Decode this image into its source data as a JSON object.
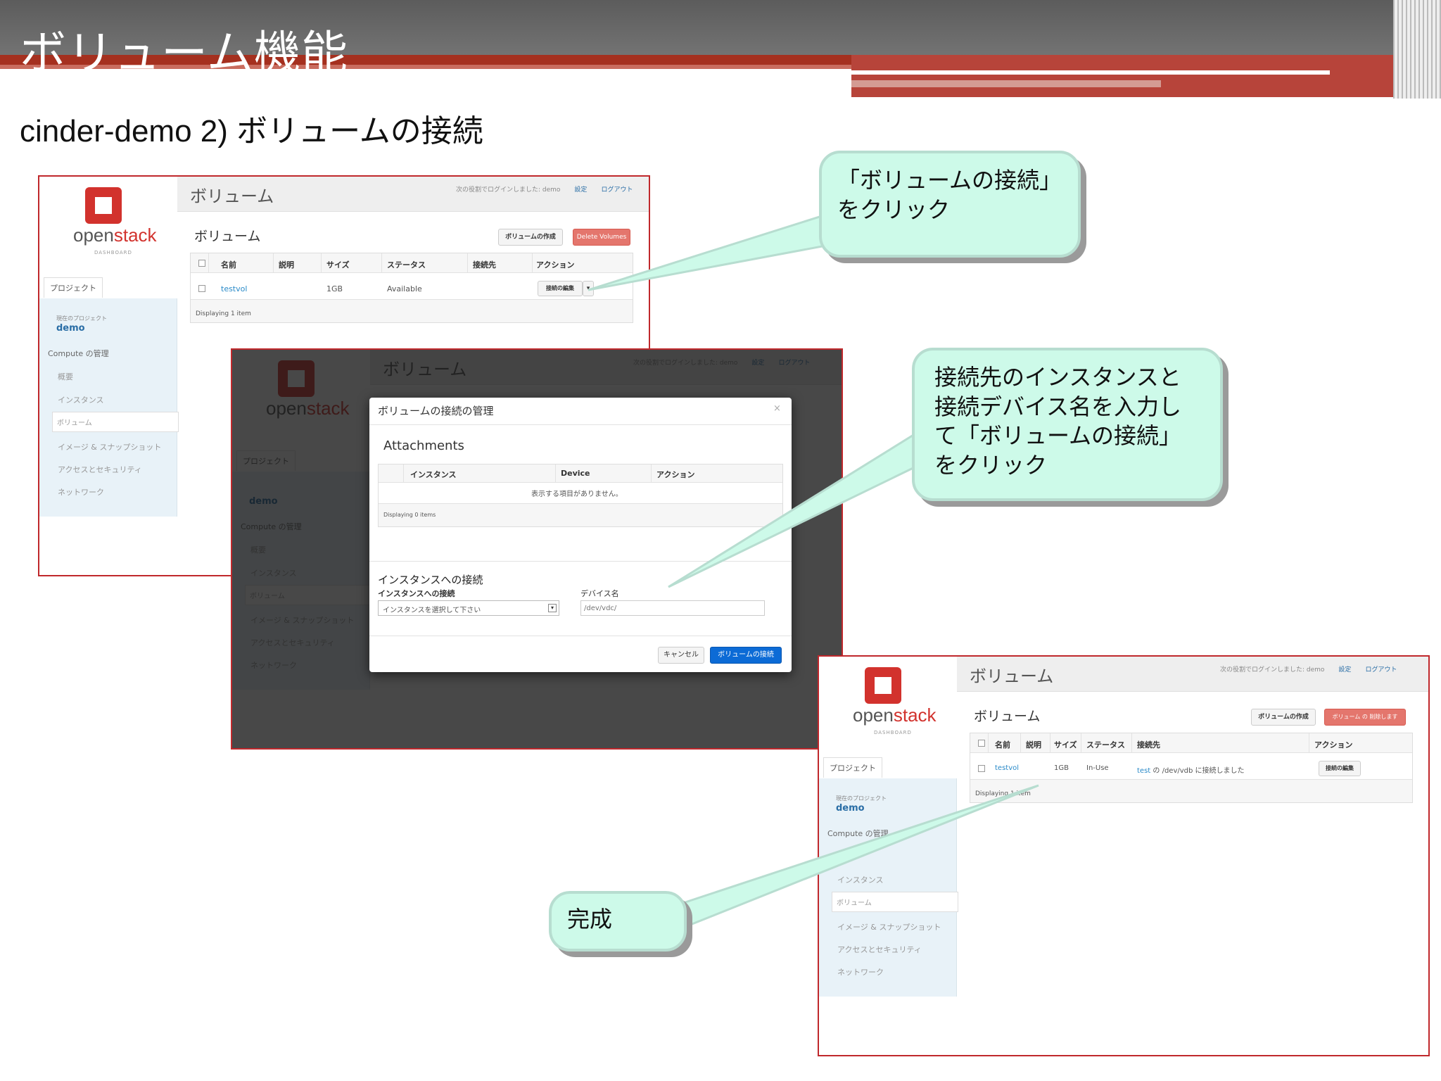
{
  "slide": {
    "title": "ボリューム機能",
    "subtitle": "cinder-demo 2) ボリュームの接続"
  },
  "dashboard": {
    "logo_open": "open",
    "logo_stack": "stack",
    "logo_sub": "DASHBOARD",
    "project_tab": "プロジェクト",
    "current_project_label": "現在のプロジェクト",
    "current_project": "demo",
    "section": "Compute の管理",
    "nav": [
      "概要",
      "インスタンス",
      "ボリューム",
      "イメージ & スナップショット",
      "アクセスとセキュリティ",
      "ネットワーク"
    ],
    "page_title": "ボリューム",
    "logged_in": "次の役割でログインしました: demo",
    "settings": "設定",
    "logout": "ログアウト",
    "table_title": "ボリューム",
    "create_btn": "ボリュームの作成",
    "columns": [
      "名前",
      "説明",
      "サイズ",
      "ステータス",
      "接続先",
      "アクション"
    ]
  },
  "shot1": {
    "delete_btn": "Delete Volumes",
    "row": {
      "name": "testvol",
      "desc": "",
      "size": "1GB",
      "status": "Available",
      "attached": "",
      "action": "接続の編集"
    },
    "footer": "Displaying 1 item"
  },
  "shot2": {
    "modal_title": "ボリュームの接続の管理",
    "close": "×",
    "attachments_title": "Attachments",
    "columns": [
      "インスタンス",
      "Device",
      "アクション"
    ],
    "empty": "表示する項目がありません。",
    "footer": "Displaying 0 items",
    "attach_title": "インスタンスへの接続",
    "instance_label": "インスタンスへの接続",
    "instance_select": "インスタンスを選択して下さい",
    "device_label": "デバイス名",
    "device_placeholder": "/dev/vdc/",
    "cancel": "キャンセル",
    "submit": "ボリュームの接続"
  },
  "shot3": {
    "delete_btn": "ボリューム の 削除します",
    "row": {
      "name": "testvol",
      "desc": "",
      "size": "1GB",
      "status": "In-Use",
      "attached_link": "test",
      "attached_rest": " の /dev/vdb に接続しました",
      "action": "接続の編集"
    },
    "footer": "Displaying 1 item"
  },
  "callouts": {
    "c1": "「ボリュームの接続」をクリック",
    "c2": "接続先のインスタンスと接続デバイス名を入力して「ボリュームの接続」をクリック",
    "c3": "完成"
  }
}
